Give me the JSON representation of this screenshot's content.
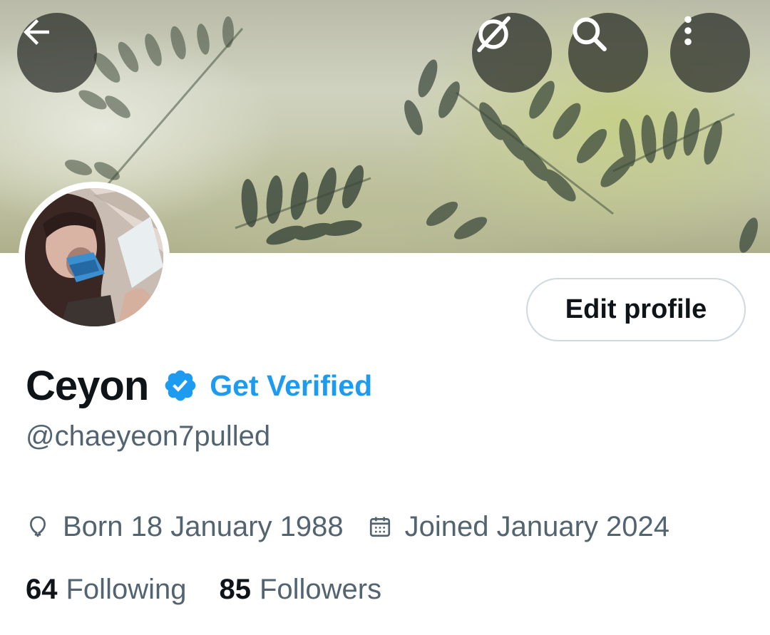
{
  "header": {
    "back_icon": "arrow-left-icon",
    "grok_icon": "grok-icon",
    "search_icon": "search-icon",
    "more_icon": "more-vertical-icon"
  },
  "profile": {
    "display_name": "Ceyon",
    "verified": true,
    "verified_icon": "verified-badge-icon",
    "get_verified_label": "Get Verified",
    "handle": "@chaeyeon7pulled",
    "edit_profile_label": "Edit profile",
    "birthday_icon": "balloon-icon",
    "birthday": "Born 18 January 1988",
    "joined_icon": "calendar-icon",
    "joined": "Joined January 2024",
    "following_count": "64",
    "following_label": "Following",
    "followers_count": "85",
    "followers_label": "Followers"
  },
  "colors": {
    "accent": "#1d9bf0",
    "text_primary": "#0f1419",
    "text_secondary": "#536471",
    "border": "#cfd9de"
  }
}
